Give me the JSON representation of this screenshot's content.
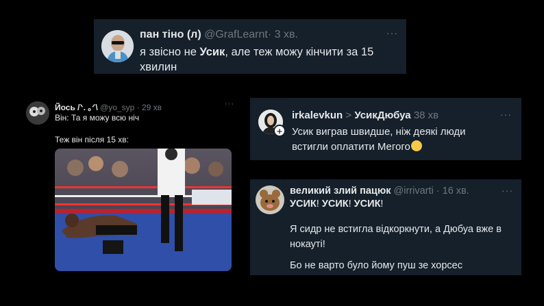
{
  "tweet1": {
    "name": "пан тіно (л)",
    "handle": "@GrafLearnt",
    "time": "· 3 хв.",
    "text_pre": "я звісно не ",
    "text_bold": "Усик",
    "text_post": ", але теж можу кінчити за 15 хвилин"
  },
  "tweet2": {
    "name": "Йось /ᐠ. ｡ᐟ\\",
    "handle": "@yo_syp",
    "time": "· 29 хв",
    "line1": "Він: Та я можу всю ніч",
    "line2": "Теж він після 15 хв:"
  },
  "tweet3": {
    "name": "irkalevkun",
    "arrow": ">",
    "reply_to": "УсикДюбуа",
    "time": "38 хв",
    "text": "Усик виграв швидше, ніж деякі люди встигли оплатити Мегого"
  },
  "tweet4": {
    "name": "великий злий пацюк",
    "handle": "@irrivarti",
    "time": "· 16 хв.",
    "shout_word": "УСИК",
    "shout_sep": "!",
    "p2": "Я сидр не встигла відкоркнути, а Дюбуа вже в нокауті!",
    "p3": "Бо не варто було йому пуш зе хорсес"
  },
  "menu_glyph": "···",
  "colors": {
    "card_bg": "#15202b",
    "text": "#e7e9ea",
    "muted": "#71767b",
    "page_bg": "#000000"
  }
}
